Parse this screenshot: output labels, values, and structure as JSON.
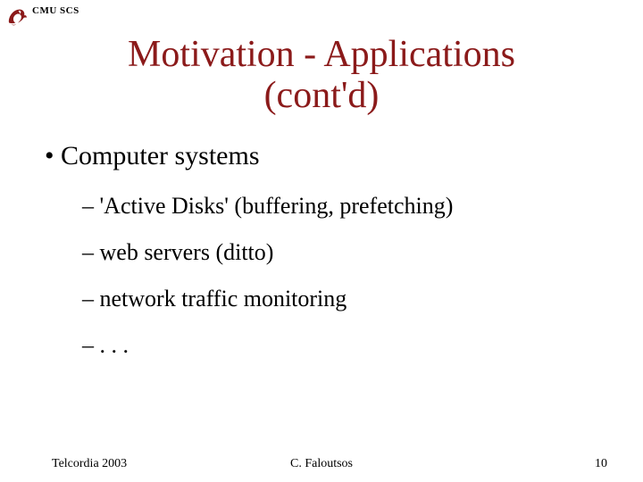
{
  "header": {
    "org": "CMU SCS"
  },
  "title_line1": "Motivation - Applications",
  "title_line2": "(cont'd)",
  "bullets": {
    "l1": "Computer systems",
    "l2_1": "'Active Disks' (buffering, prefetching)",
    "l2_2": "web servers (ditto)",
    "l2_3": "network traffic monitoring",
    "l2_4": ". . ."
  },
  "footer": {
    "left": "Telcordia 2003",
    "center": "C. Faloutsos",
    "right": "10"
  }
}
